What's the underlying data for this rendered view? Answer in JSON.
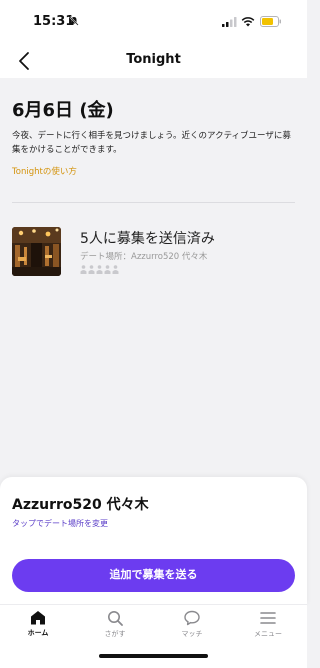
{
  "status_bar": {
    "time": "15:31"
  },
  "nav": {
    "title": "Tonight"
  },
  "main": {
    "date": "6月6日 (金)",
    "description": "今夜、デートに行く相手を見つけましょう。近くのアクティブユーザに募集をかけることができます。",
    "howto_link": "Tonightの使い方",
    "sent_title": "5人に募集を送信済み",
    "venue_line": "デート場所：Azzurro520 代々木",
    "people_count": 5
  },
  "sheet": {
    "venue_name": "Azzurro520 代々木",
    "change_link": "タップでデート場所を変更",
    "send_button": "追加で募集を送る"
  },
  "tabs": [
    {
      "label": "ホーム",
      "icon": "home-icon",
      "active": true
    },
    {
      "label": "さがす",
      "icon": "search-icon",
      "active": false
    },
    {
      "label": "マッチ",
      "icon": "chat-bubble-icon",
      "active": false
    },
    {
      "label": "メニュー",
      "icon": "menu-icon",
      "active": false
    }
  ],
  "colors": {
    "accent_purple": "#6c3cf0",
    "link_orange": "#d4930b",
    "link_purple": "#5b3ec8",
    "background": "#f2f2f4"
  }
}
